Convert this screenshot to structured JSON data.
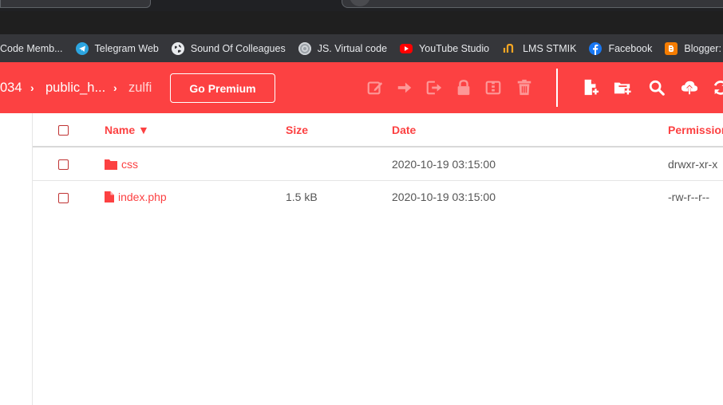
{
  "bookmarks": [
    {
      "label": "Code Memb...",
      "icon": "none"
    },
    {
      "label": "Telegram Web",
      "icon": "telegram-icon"
    },
    {
      "label": "Sound Of Colleagues",
      "icon": "globe-icon"
    },
    {
      "label": "JS. Virtual code",
      "icon": "js-virtual-icon"
    },
    {
      "label": "YouTube Studio",
      "icon": "youtube-icon"
    },
    {
      "label": "LMS STMIK",
      "icon": "lms-icon"
    },
    {
      "label": "Facebook",
      "icon": "facebook-icon"
    },
    {
      "label": "Blogger: Posting",
      "icon": "blogger-icon"
    }
  ],
  "breadcrumb": {
    "items": [
      "034",
      "public_h...",
      "zulfi"
    ],
    "separator": "›"
  },
  "header": {
    "premium_label": "Go Premium",
    "toolbar_icons": [
      "edit-icon",
      "move-icon",
      "copy-icon",
      "lock-icon",
      "archive-icon",
      "delete-icon",
      "new-file-icon",
      "new-folder-icon",
      "search-icon",
      "upload-icon",
      "refresh-icon"
    ]
  },
  "table": {
    "columns": {
      "name": "Name ▼",
      "size": "Size",
      "date": "Date",
      "permissions": "Permission"
    },
    "rows": [
      {
        "type": "folder",
        "name": "css",
        "size": "",
        "date": "2020-10-19 03:15:00",
        "permissions": "drwxr-xr-x"
      },
      {
        "type": "file",
        "name": "index.php",
        "size": "1.5 kB",
        "date": "2020-10-19 03:15:00",
        "permissions": "-rw-r--r--"
      }
    ]
  },
  "colors": {
    "accent": "#fc4142",
    "bookmarks_bar": "#35363a",
    "text_muted": "#555555"
  }
}
